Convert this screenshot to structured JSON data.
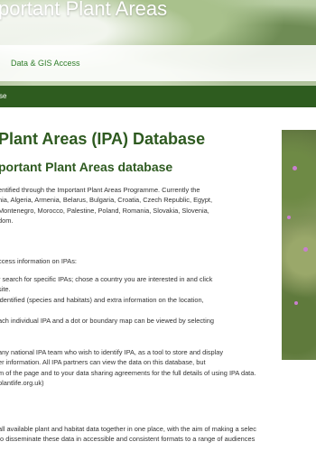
{
  "header": {
    "site_title": "portant Plant Areas",
    "nav_link": "Data & GIS Access"
  },
  "breadcrumb": {
    "text": "se"
  },
  "main": {
    "page_title": "Plant Areas (IPA) Database",
    "sub_title": "portant Plant Areas database",
    "intro": [
      "entified through the Important Plant Areas Programme. Currently the",
      "nia, Algeria, Armenia, Belarus, Bulgaria, Croatia, Czech Republic, Egypt,",
      "Montenegro, Morocco, Palestine, Poland, Romania, Slovakia, Slovenia,",
      "dom."
    ],
    "access_intro": "ccess information on IPAs:",
    "access_lines": [
      "r search for specific IPAs; chose a country you are interested in and click",
      "site.",
      "identified (species and habitats) and extra information on the location,",
      "",
      "ach individual IPA and a dot or boundary map can be viewed by selecting"
    ],
    "team_lines": [
      "any national IPA team who wish to identify IPA, as a tool to store and display",
      "er information. All IPA partners can view the data on this database, but",
      "m of the page and to your data sharing agreements for the full details of using IPA data.",
      "plantlife.org.uk)"
    ],
    "closing_lines": [
      "all available plant and habitat data together in one place, with the aim of making a selec",
      "to disseminate these data in accessible and consistent formats to a range of audiences"
    ]
  },
  "colors": {
    "heading_green": "#2e5a20",
    "bar_green": "#2e5c1f",
    "link_green": "#2f7d2a"
  },
  "icons": {
    "photo": "ipa-landscape-photo"
  }
}
